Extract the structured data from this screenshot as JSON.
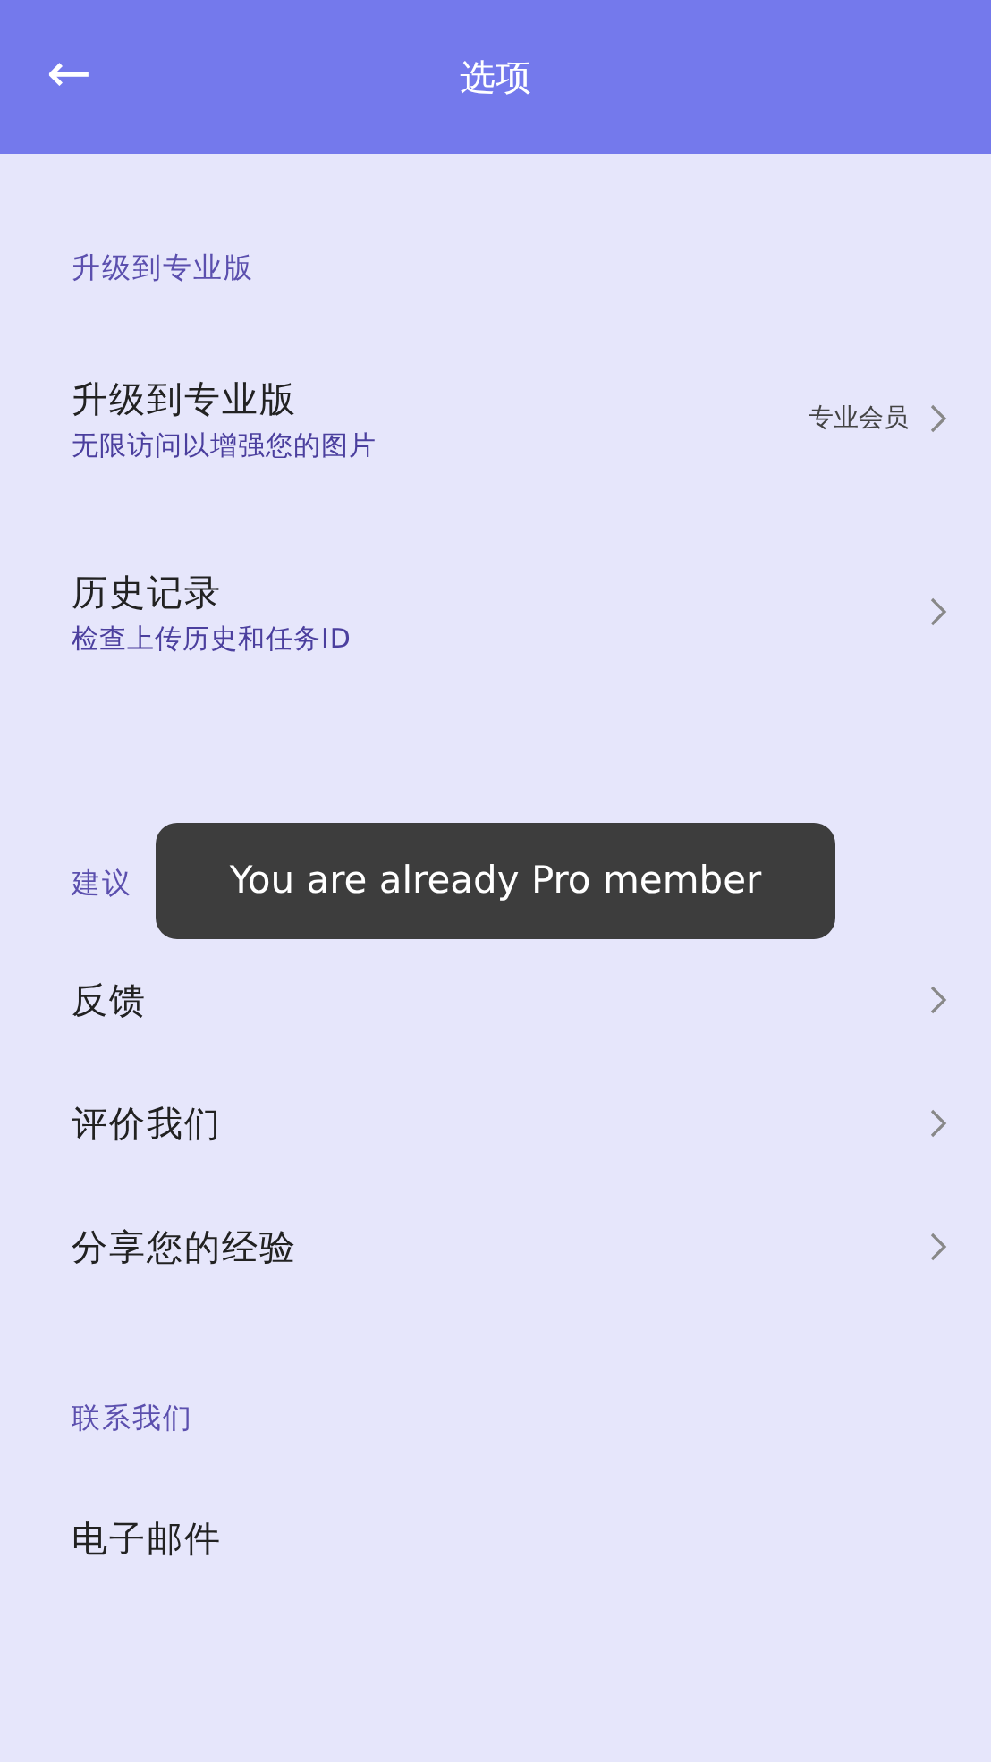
{
  "header": {
    "back": "←",
    "title": "选项"
  },
  "sections": [
    {
      "title": "升级到专业版",
      "items": [
        {
          "title": "升级到专业版",
          "subtitle": "无限访问以增强您的图片",
          "value": "专业会员",
          "chevron": true
        },
        {
          "title": "历史记录",
          "subtitle": "检查上传历史和任务ID",
          "chevron": true
        }
      ]
    },
    {
      "title": "建议",
      "items": [
        {
          "title": "反馈",
          "chevron": true
        },
        {
          "title": "评价我们",
          "chevron": true
        },
        {
          "title": "分享您的经验",
          "chevron": true
        }
      ]
    },
    {
      "title": "联系我们",
      "items": [
        {
          "title": "电子邮件",
          "chevron": false
        }
      ]
    }
  ],
  "toast": "You are already Pro member"
}
